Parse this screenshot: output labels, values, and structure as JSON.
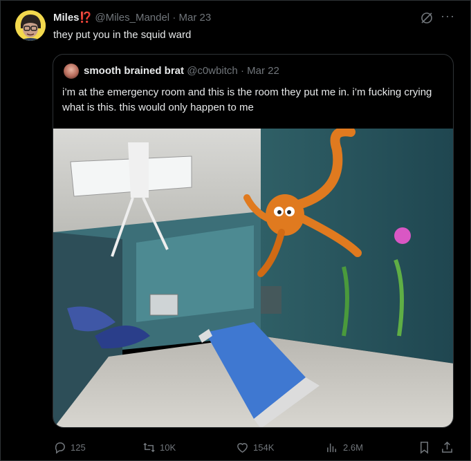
{
  "tweet": {
    "author_name": "Miles",
    "author_badge": "⁉️",
    "author_handle": "@Miles_Mandel",
    "separator": "·",
    "date": "Mar 23",
    "text": "they put you in the squid ward"
  },
  "quoted_tweet": {
    "author_name": "smooth brained brat",
    "author_handle": "@c0wbitch",
    "separator": "·",
    "date": "Mar 22",
    "text": "i’m at the emergency room and this is the room they put me in. i’m fucking crying what is this. this would only happen to me"
  },
  "actions": {
    "replies": "125",
    "reposts": "10K",
    "likes": "154K",
    "views": "2.6M"
  },
  "icons": [
    "grok-icon",
    "more-icon",
    "reply-icon",
    "repost-icon",
    "like-icon",
    "views-icon",
    "bookmark-icon",
    "share-icon"
  ],
  "colors": {
    "background": "#000000",
    "text": "#e7e9ea",
    "muted": "#71767b",
    "border": "#2f3336",
    "badge": "#f4212e"
  }
}
